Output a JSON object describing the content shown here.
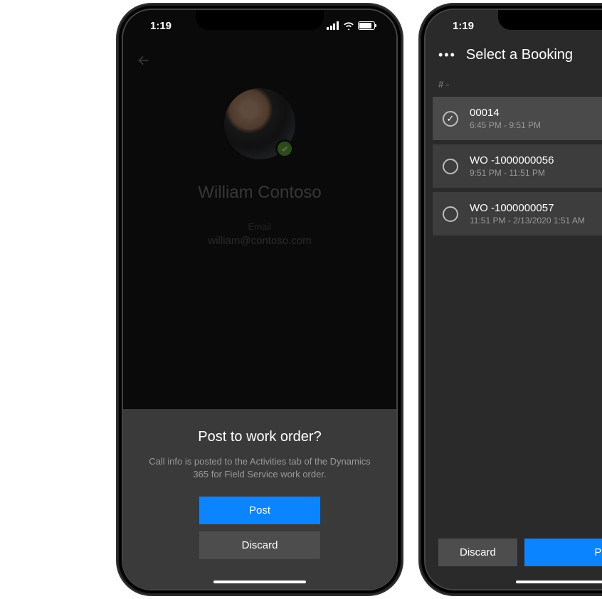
{
  "status": {
    "time": "1:19"
  },
  "phone1": {
    "contact": {
      "name": "William Contoso",
      "email_label": "Email",
      "email": "william@contoso.com"
    },
    "sheet": {
      "title": "Post to work order?",
      "description": "Call info is posted to the Activities tab of the Dynamics 365 for Field Service work order.",
      "post_label": "Post",
      "discard_label": "Discard"
    }
  },
  "phone2": {
    "header_title": "Select a Booking",
    "section_label": "# -",
    "bookings": [
      {
        "id": "00014",
        "time": "6:45 PM - 9:51 PM",
        "selected": true
      },
      {
        "id": "WO -1000000056",
        "time": "9:51 PM - 11:51 PM",
        "selected": false
      },
      {
        "id": "WO -1000000057",
        "time": "11:51 PM - 2/13/2020 1:51 AM",
        "selected": false
      }
    ],
    "footer": {
      "discard_label": "Discard",
      "post_label": "Post"
    }
  }
}
